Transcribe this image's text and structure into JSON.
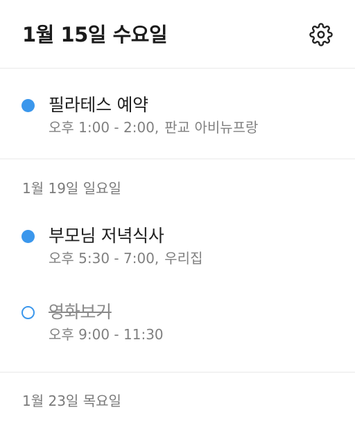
{
  "header": {
    "title": "1월 15일 수요일",
    "settings_icon": "gear-icon"
  },
  "accent_color": "#3b97ec",
  "sections": [
    {
      "date_label": "",
      "events": [
        {
          "title": "필라테스 예약",
          "time": "오후 1:00 - 2:00,",
          "location": "판교 아비뉴프랑",
          "status": "scheduled"
        }
      ]
    },
    {
      "date_label": "1월 19일 일요일",
      "events": [
        {
          "title": "부모님 저녁식사",
          "time": "오후 5:30 - 7:00,",
          "location": "우리집",
          "status": "scheduled"
        },
        {
          "title": "영화보기",
          "time": "오후 9:00 - 11:30",
          "location": "",
          "status": "completed"
        }
      ]
    },
    {
      "date_label": "1월 23일 목요일",
      "events": []
    }
  ]
}
